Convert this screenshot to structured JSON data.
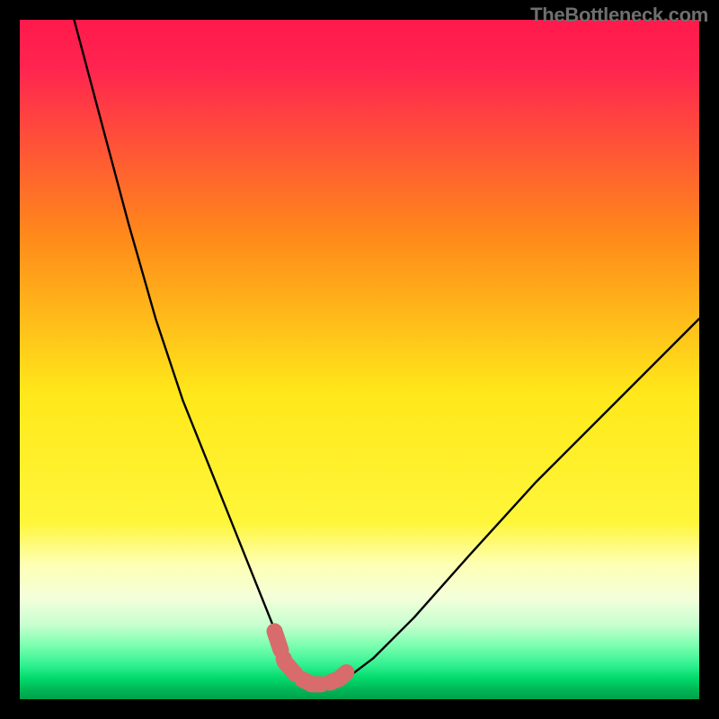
{
  "watermark": {
    "text": "TheBottleneck.com"
  },
  "colors": {
    "frame": "#000000",
    "watermark": "#6f6f6f",
    "curve": "#000000",
    "marker": "#d86b6b",
    "gradient_top": "#ff1a4b",
    "gradient_mid_upper": "#ff8a1a",
    "gradient_mid": "#ffe81a",
    "gradient_pale": "#feffb2",
    "gradient_green": "#00e06a",
    "gradient_bottom": "#00a04a"
  },
  "chart_data": {
    "type": "line",
    "title": "",
    "xlabel": "",
    "ylabel": "",
    "xlim": [
      0,
      100
    ],
    "ylim": [
      0,
      100
    ],
    "series": [
      {
        "name": "bottleneck-curve",
        "x": [
          8,
          12,
          16,
          20,
          24,
          28,
          32,
          36,
          38,
          40,
          42,
          44,
          46,
          48,
          52,
          58,
          66,
          76,
          88,
          100
        ],
        "values": [
          100,
          85,
          70,
          56,
          44,
          34,
          24,
          14,
          9,
          5,
          3,
          2,
          2,
          3,
          6,
          12,
          21,
          32,
          44,
          56
        ]
      }
    ],
    "marker_region": {
      "name": "optimal-zone",
      "x": [
        37.5,
        39,
        41,
        43,
        45,
        47,
        49
      ],
      "values": [
        10,
        5.5,
        3.2,
        2.2,
        2.2,
        3.0,
        4.8
      ]
    },
    "gradient_stops_pct": [
      0,
      32,
      55,
      74,
      80,
      85,
      89,
      92,
      95,
      97,
      98.5,
      100
    ],
    "gradient_is_vertical": true
  }
}
